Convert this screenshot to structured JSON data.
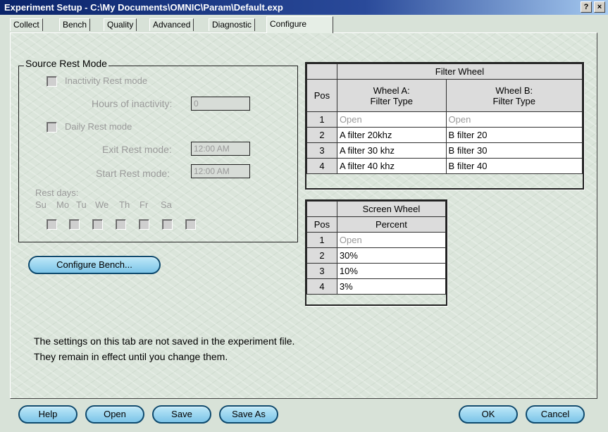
{
  "window": {
    "title": "Experiment Setup - C:\\My Documents\\OMNIC\\Param\\Default.exp",
    "help_glyph": "?",
    "close_glyph": "×"
  },
  "tabs": [
    {
      "label": "Collect"
    },
    {
      "label": "Bench"
    },
    {
      "label": "Quality"
    },
    {
      "label": "Advanced"
    },
    {
      "label": "Diagnostic"
    },
    {
      "label": "Configure"
    }
  ],
  "source_rest": {
    "title": "Source Rest Mode",
    "inactivity_label": "Inactivity Rest mode",
    "hours_label": "Hours of inactivity:",
    "hours_value": "0",
    "daily_label": "Daily Rest mode",
    "exit_label": "Exit Rest mode:",
    "exit_value": "12:00 AM",
    "start_label": "Start Rest mode:",
    "start_value": "12:00 AM",
    "rest_days_label": "Rest days:",
    "days": [
      "Su",
      "Mo",
      "Tu",
      "We",
      "Th",
      "Fr",
      "Sa"
    ]
  },
  "configure_bench_label": "Configure Bench...",
  "filter_wheel": {
    "title": "Filter Wheel",
    "pos_header": "Pos",
    "col_a_line1": "Wheel A:",
    "col_a_line2": "Filter Type",
    "col_b_line1": "Wheel B:",
    "col_b_line2": "Filter Type",
    "rows": [
      {
        "pos": "1",
        "a": "Open",
        "b": "Open"
      },
      {
        "pos": "2",
        "a": "A filter 20khz",
        "b": "B filter 20"
      },
      {
        "pos": "3",
        "a": "A filter 30 khz",
        "b": "B filter 30"
      },
      {
        "pos": "4",
        "a": "A filter 40 khz",
        "b": "B filter 40"
      }
    ]
  },
  "screen_wheel": {
    "title": "Screen Wheel",
    "pos_header": "Pos",
    "col_header": "Percent",
    "rows": [
      {
        "pos": "1",
        "v": "Open"
      },
      {
        "pos": "2",
        "v": "30%"
      },
      {
        "pos": "3",
        "v": "10%"
      },
      {
        "pos": "4",
        "v": "3%"
      }
    ]
  },
  "note_line1": "The settings on this tab are not saved in the experiment file.",
  "note_line2": "They remain in effect until you change them.",
  "buttons": {
    "help": "Help",
    "open": "Open",
    "save": "Save",
    "save_as": "Save As",
    "ok": "OK",
    "cancel": "Cancel"
  }
}
